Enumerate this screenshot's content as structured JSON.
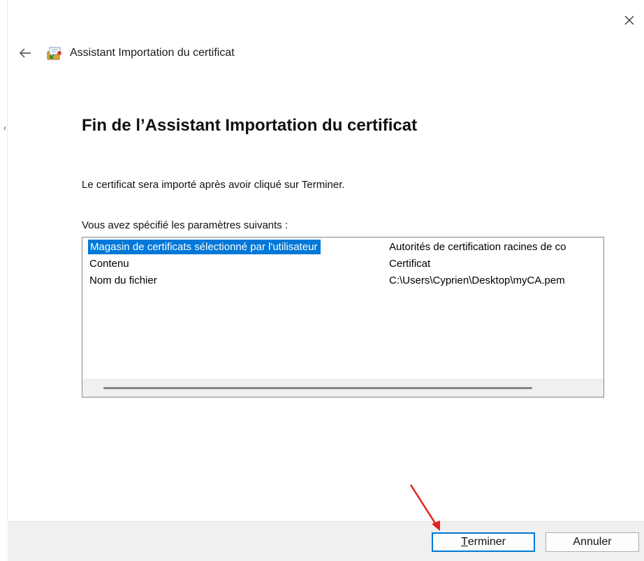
{
  "window": {
    "header_title": "Assistant Importation du certificat",
    "close_glyph": "✕"
  },
  "main": {
    "title": "Fin de l’Assistant Importation du certificat",
    "description": "Le certificat sera importé après avoir cliqué sur Terminer.",
    "params_label": "Vous avez spécifié les paramètres suivants :",
    "params": [
      {
        "key": "Magasin de certificats sélectionné par l'utilisateur",
        "value": "Autorités de certification racines de co",
        "selected": true
      },
      {
        "key": "Contenu",
        "value": "Certificat",
        "selected": false
      },
      {
        "key": "Nom du fichier",
        "value": "C:\\Users\\Cyprien\\Desktop\\myCA.pem",
        "selected": false
      }
    ]
  },
  "footer": {
    "finish_first": "T",
    "finish_rest": "erminer",
    "cancel_label": "Annuler"
  },
  "colors": {
    "selection": "#0078d7",
    "annotation_arrow": "#e0201e",
    "footer_bg": "#f0f0f0"
  },
  "icons": [
    "back-arrow-icon",
    "certificate-icon",
    "close-icon",
    "annotation-arrow-icon"
  ]
}
